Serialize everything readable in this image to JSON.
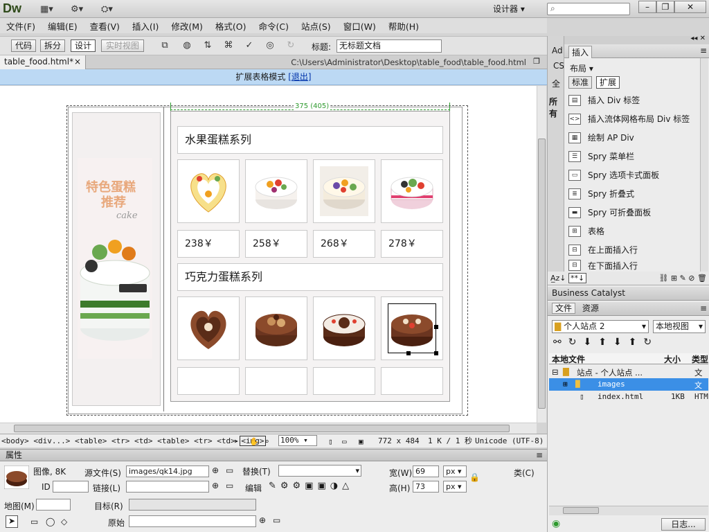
{
  "app": {
    "logo": "Dw",
    "workspace": "设计器",
    "search_placeholder": ""
  },
  "menu": [
    "文件(F)",
    "编辑(E)",
    "查看(V)",
    "插入(I)",
    "修改(M)",
    "格式(O)",
    "命令(C)",
    "站点(S)",
    "窗口(W)",
    "帮助(H)"
  ],
  "doc_toolbar": {
    "code": "代码",
    "split": "拆分",
    "design": "设计",
    "live": "实时视图",
    "title_label": "标题:",
    "title_value": "无标题文档"
  },
  "tab": {
    "name": "table_food.html*",
    "close": "×",
    "path": "C:\\Users\\Administrator\\Desktop\\table_food\\table_food.html"
  },
  "banner": {
    "text": "扩展表格模式",
    "exit": "[退出]"
  },
  "page": {
    "width_label": "375 (405)",
    "side_title_1": "特色蛋糕",
    "side_title_2": "推荐",
    "side_cake": "cake",
    "fruit_title": "水果蛋糕系列",
    "choc_title": "巧克力蛋糕系列",
    "prices": [
      "238￥",
      "258￥",
      "268￥",
      "278￥"
    ]
  },
  "tagbar": {
    "tags": "<body> <div...> <table> <tr> <td> <table> <tr> <td>",
    "current": "<img>",
    "zoom": "100%",
    "dims": "772 x 484",
    "size": "1 K / 1 秒",
    "encoding": "Unicode (UTF-8)"
  },
  "props": {
    "header": "属性",
    "type_label": "图像, 8K",
    "id_label": "ID",
    "src_label": "源文件(S)",
    "src_value": "images/qk14.jpg",
    "link_label": "链接(L)",
    "alt_label": "替换(T)",
    "edit_label": "编辑",
    "width_label": "宽(W)",
    "width_value": "69",
    "height_label": "高(H)",
    "height_value": "73",
    "unit": "px",
    "class_label": "类(C)",
    "map_label": "地图(M)",
    "target_label": "目标(R)",
    "orig_label": "原始"
  },
  "insert_panel": {
    "strip_tabs": [
      "Ad",
      "CS",
      "全",
      "所有"
    ],
    "tab": "插入",
    "category": "布局",
    "modes": [
      "标准",
      "扩展"
    ],
    "items": [
      "插入 Div 标签",
      "插入流体网格布局 Div 标签",
      "绘制 AP Div",
      "Spry 菜单栏",
      "Spry 选项卡式面板",
      "Spry 折叠式",
      "Spry 可折叠面板",
      "表格",
      "在上面插入行",
      "在下面插入行"
    ]
  },
  "files_panel": {
    "bc": "Business Catalyst",
    "tabs": [
      "文件",
      "资源"
    ],
    "site": "个人站点 2",
    "view": "本地视图",
    "col_local": "本地文件",
    "col_size": "大小",
    "col_type": "类型",
    "rows": [
      {
        "name": "站点 - 个人站点 ...",
        "size": "",
        "type": "文件"
      },
      {
        "name": "images",
        "size": "",
        "type": "文件"
      },
      {
        "name": "index.html",
        "size": "1KB",
        "type": "HTM"
      }
    ],
    "log": "日志..."
  },
  "colors": {
    "banner": "#bcd9f4",
    "selection": "#3b8fe6",
    "cake_title": "#e8a87c"
  }
}
